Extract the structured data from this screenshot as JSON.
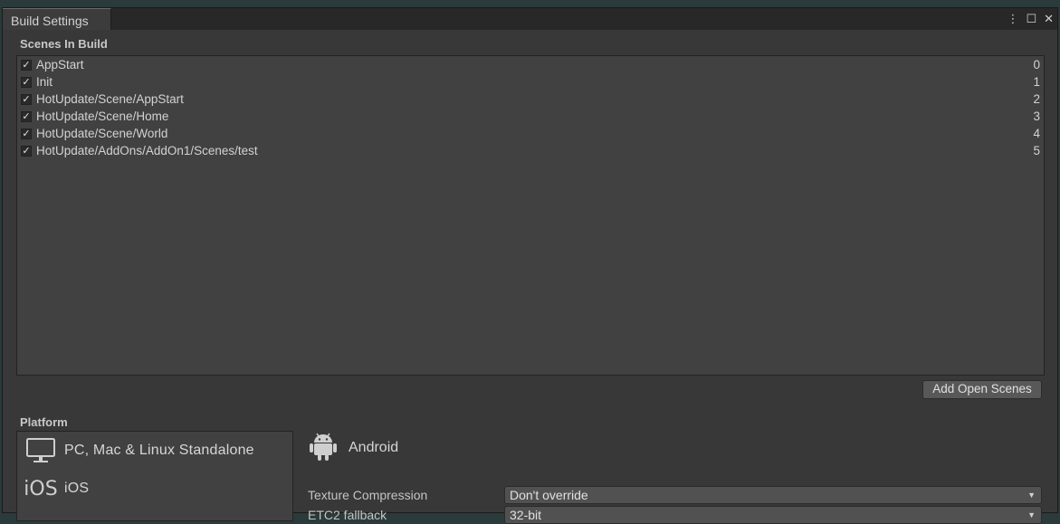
{
  "window": {
    "tab_title": "Build Settings",
    "controls": {
      "menu": "⋮",
      "maximize": "☐",
      "close": "✕"
    }
  },
  "scenes": {
    "header": "Scenes In Build",
    "items": [
      {
        "name": "AppStart",
        "index": "0",
        "checked": true
      },
      {
        "name": "Init",
        "index": "1",
        "checked": true
      },
      {
        "name": "HotUpdate/Scene/AppStart",
        "index": "2",
        "checked": true
      },
      {
        "name": "HotUpdate/Scene/Home",
        "index": "3",
        "checked": true
      },
      {
        "name": "HotUpdate/Scene/World",
        "index": "4",
        "checked": true
      },
      {
        "name": "HotUpdate/AddOns/AddOn1/Scenes/test",
        "index": "5",
        "checked": true
      }
    ],
    "add_open_scenes_label": "Add Open Scenes"
  },
  "platform": {
    "header": "Platform",
    "items": [
      {
        "label": "PC, Mac & Linux Standalone",
        "icon": "monitor-icon"
      },
      {
        "label": "iOS",
        "icon": "ios-icon",
        "icon_text": "iOS"
      }
    ],
    "selected": {
      "label": "Android",
      "icon": "android-icon"
    }
  },
  "settings": {
    "texture_compression": {
      "label": "Texture Compression",
      "value": "Don't override"
    },
    "etc2_fallback": {
      "label": "ETC2 fallback",
      "value": "32-bit"
    }
  }
}
